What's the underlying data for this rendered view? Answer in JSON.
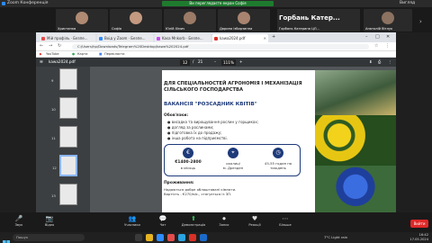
{
  "zoom": {
    "window_title": "Zoom Конференція",
    "share_banner": "Ви переглядаєте екран Софія",
    "view_label": "Вигляд"
  },
  "participants": [
    {
      "name": "Христинка"
    },
    {
      "name": "Софія"
    },
    {
      "name": "Юлій Хімич"
    },
    {
      "name": "Дарина Ізбирзинна"
    },
    {
      "name": "Анатолій Вітлук"
    }
  ],
  "speaker_tile": {
    "big_name": "Горбань Катер...",
    "name": "Горбань Катерина ЦЛ..."
  },
  "browser": {
    "tabs": [
      {
        "label": "Мій профіль · Безпе...",
        "color": "#e34c4c"
      },
      {
        "label": "Вхід у Zoom · Безпе...",
        "color": "#2d8cff"
      },
      {
        "label": "Kasa Mnkorb · Безпе...",
        "color": "#c84cf0"
      },
      {
        "label": "kawa2024.pdf",
        "color": "#d93025"
      }
    ],
    "url": "C:/Users/hp/Downloads/Telegram%20Desktop/kawa%202024.pdf",
    "bookmarks": [
      "YouTube",
      "Карти",
      "Перекласти"
    ]
  },
  "pdf": {
    "file_name": "kawa2024.pdf",
    "page_current": "12",
    "page_total": "21",
    "zoom": "111%",
    "thumb_pages": [
      "9",
      "10",
      "11",
      "12",
      "13"
    ]
  },
  "page": {
    "title": "ДЛЯ СПЕЦІАЛЬНОСТЕЙ АГРОНОМІЯ І МЕХАНІЗАЦІЯ СІЛЬСЬКОГО ГОСПОДАРСТВА",
    "vacancy": "ВАКАНСІЯ \"РОЗСАДНИК КВІТІВ\"",
    "duties_heading": "Обов'язки:",
    "duties": [
      "висадка та вирощування рослин у горщиках;",
      "догляд за рослинами;",
      "підготовка їх до продажу;",
      "інша робота на підприємстві."
    ],
    "features": [
      {
        "icon": "€",
        "top": "€1400-2800",
        "bottom": "в місяць"
      },
      {
        "icon": "⌖",
        "top": "околиці",
        "bottom": "м. Дрезден"
      },
      {
        "icon": "◷",
        "top": "",
        "bottom": "45-55 годин на тиждень"
      }
    ],
    "accommodation_heading": "Проживання:",
    "accommodation_lines": [
      "Надаються добре облаштовані кімнати.",
      "Вартість - €270/міс., стягується із ЗП."
    ]
  },
  "toolbar": [
    {
      "icon": "🎤",
      "label": "Звук"
    },
    {
      "icon": "📷",
      "label": "Відео"
    },
    {
      "icon": "👥",
      "label": "Учасники"
    },
    {
      "icon": "💬",
      "label": "Чат"
    },
    {
      "icon": "⬆",
      "label": "Демонстрація"
    },
    {
      "icon": "⏺",
      "label": "Запис"
    },
    {
      "icon": "♥",
      "label": "Реакції"
    },
    {
      "icon": "⋯",
      "label": "Більше"
    }
  ],
  "end_label": "Вийти",
  "taskbar": {
    "search_placeholder": "Пошук",
    "weather": "7°C Light rain",
    "time": "16:42",
    "date": "17.05.2024"
  },
  "colors": {
    "accent": "#1e3a7a",
    "zoom_green": "#1e7b2e",
    "end_red": "#e02828"
  }
}
